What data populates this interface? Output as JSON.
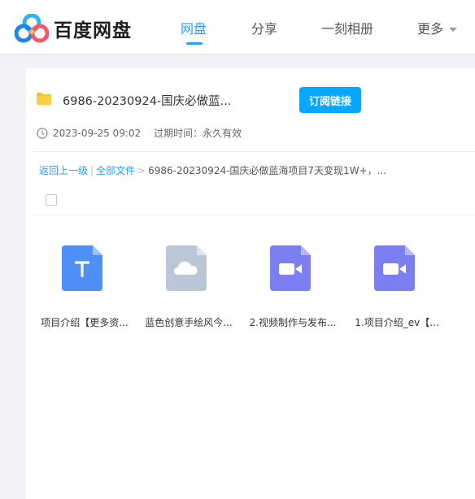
{
  "brand": {
    "name": "百度网盘",
    "logo_icon": "baidu-netdisk-logo-icon"
  },
  "nav": {
    "items": [
      {
        "label": "网盘",
        "active": true
      },
      {
        "label": "分享",
        "active": false
      },
      {
        "label": "一刻相册",
        "active": false
      },
      {
        "label": "更多",
        "active": false,
        "icon": "chevron-down-icon"
      }
    ]
  },
  "share": {
    "title": "6986-20230924-国庆必做蓝...",
    "subscribe_label": "订阅链接",
    "date": "2023-09-25 09:02",
    "expire_label": "过期时间：永久有效"
  },
  "breadcrumb": {
    "back": "返回上一级",
    "sep1": "|",
    "all_files": "全部文件",
    "sep2": ">",
    "current": "6986-20230924-国庆必做蓝海项目7天变现1W+，..."
  },
  "files": [
    {
      "name": "项目介绍【更多资...",
      "type": "text",
      "icon": "text-file-icon",
      "color": "#4e8ff7"
    },
    {
      "name": "蓝色创意手绘风今...",
      "type": "cloud",
      "icon": "cloud-file-icon",
      "color": "#b9c7d6"
    },
    {
      "name": "2.视频制作与发布...",
      "type": "video",
      "icon": "video-file-icon",
      "color": "#7b7ff0"
    },
    {
      "name": "1.项目介绍_ev【...",
      "type": "video",
      "icon": "video-file-icon",
      "color": "#7b7ff0"
    }
  ],
  "colors": {
    "accent": "#2a9ff5",
    "button": "#06a7ff"
  }
}
